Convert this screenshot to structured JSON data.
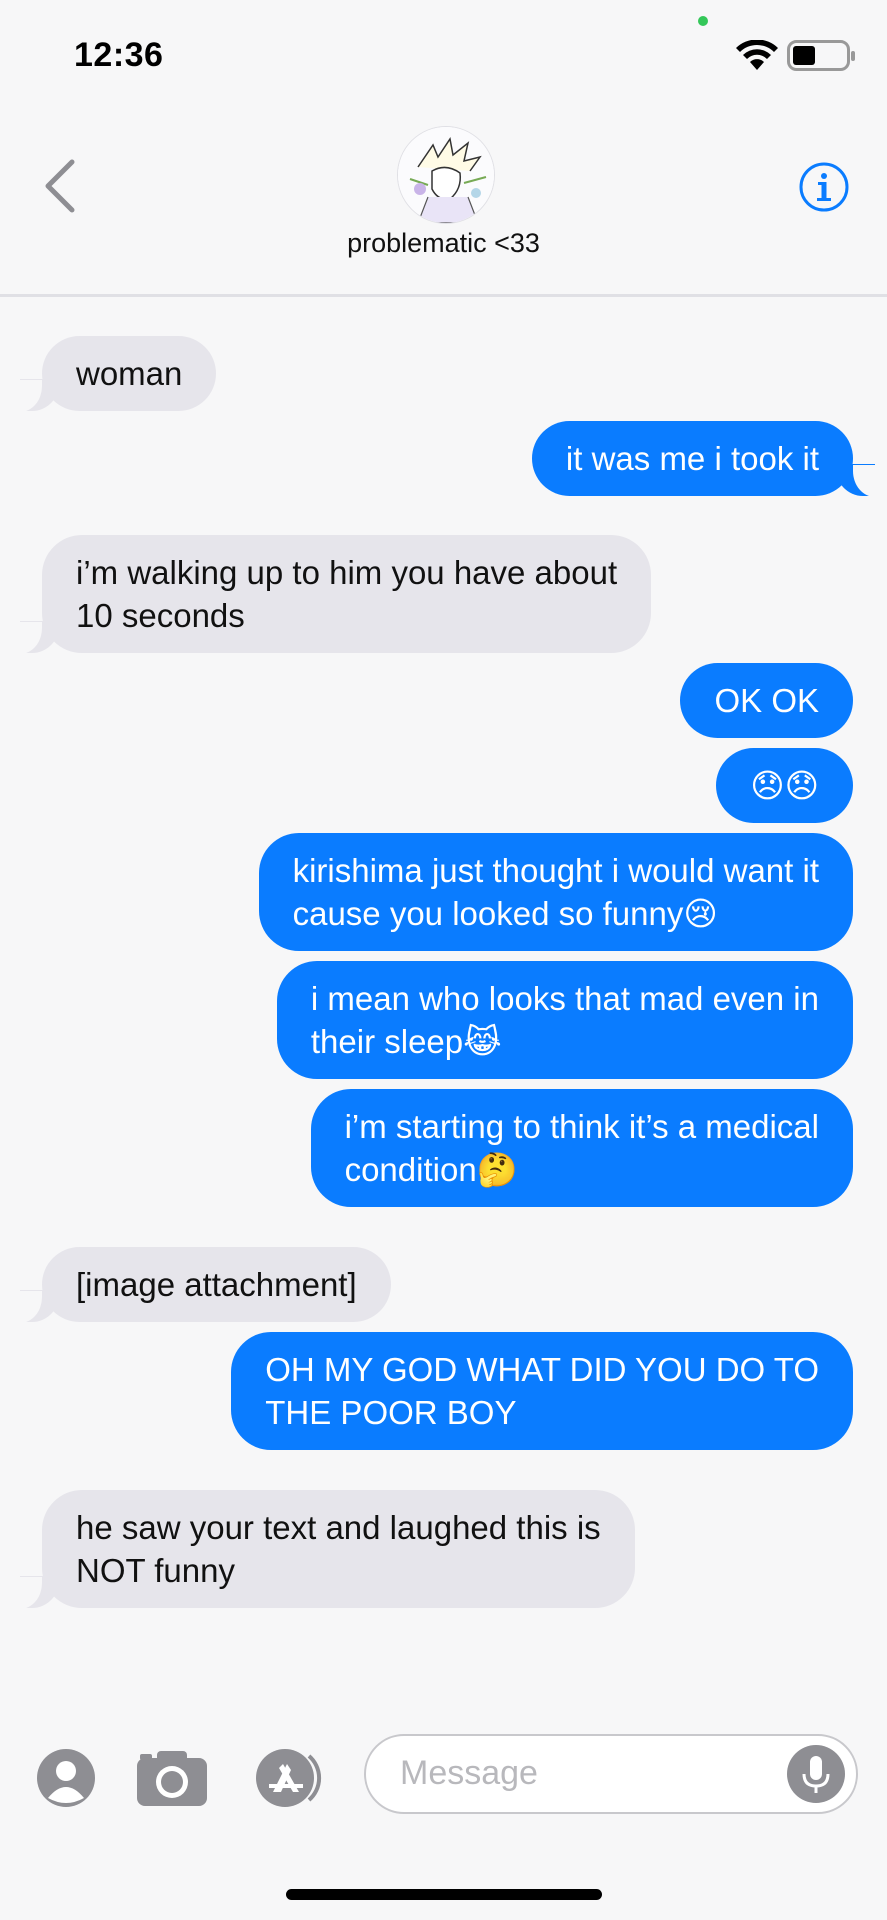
{
  "status_bar": {
    "time": "12:36",
    "indicator_color": "#34c759",
    "wifi_icon": "wifi-icon",
    "battery_icon": "battery-icon"
  },
  "header": {
    "contact_name": "problematic <33",
    "back_icon": "chevron-left-icon",
    "info_icon": "info-icon"
  },
  "colors": {
    "outgoing": "#0a7cff",
    "incoming": "#e6e5eb",
    "accent": "#0a7cff",
    "background": "#f7f7f8"
  },
  "messages": [
    {
      "side": "in",
      "text": "woman"
    },
    {
      "side": "out",
      "text": "it was me i took it"
    },
    {
      "side": "in",
      "text": "i’m walking up to him you have about\n10 seconds"
    },
    {
      "side": "out",
      "text": "OK OK"
    },
    {
      "side": "out",
      "text": "😞😞"
    },
    {
      "side": "out",
      "text": "kirishima just thought i would want it\ncause you looked so funny😢"
    },
    {
      "side": "out",
      "text": "i mean who looks that mad even in\ntheir sleep😹"
    },
    {
      "side": "out",
      "text": "i’m starting to think it’s a medical\ncondition🤔"
    },
    {
      "side": "in",
      "text": "[image attachment]"
    },
    {
      "side": "out",
      "text": "OH MY GOD WHAT DID YOU DO TO\nTHE POOR BOY"
    },
    {
      "side": "in",
      "text": "he saw your text and laughed this is\nNOT funny"
    }
  ],
  "input_bar": {
    "placeholder": "Message",
    "contacts_icon": "contact-icon",
    "camera_icon": "camera-icon",
    "appstore_icon": "app-store-icon",
    "mic_icon": "microphone-icon"
  }
}
